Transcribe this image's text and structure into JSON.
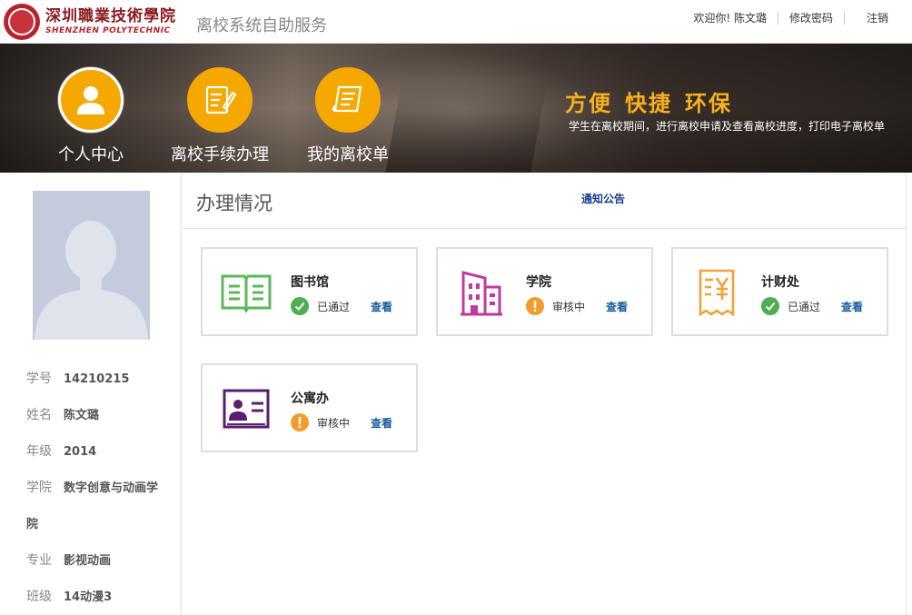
{
  "header": {
    "school_name_cn": "深圳職業技術學院",
    "school_name_en": "SHENZHEN POLYTECHNIC",
    "system_title": "离校系统自助服务",
    "welcome": "欢迎你! 陈文璐",
    "change_password": "修改密码",
    "logout": "注销"
  },
  "banner": {
    "nav": [
      {
        "label": "个人中心",
        "icon": "user-icon",
        "active": true
      },
      {
        "label": "离校手续办理",
        "icon": "edit-form-icon",
        "active": false
      },
      {
        "label": "我的离校单",
        "icon": "scroll-document-icon",
        "active": false
      }
    ],
    "slogan": [
      "方便",
      "快捷",
      "环保"
    ],
    "slogan_sub": "学生在离校期间，进行离校申请及查看离校进度，打印电子离校单"
  },
  "profile": {
    "avatar_icon": "avatar-placeholder-icon",
    "fields": [
      {
        "key": "学号",
        "value": "14210215"
      },
      {
        "key": "姓名",
        "value": "陈文璐"
      },
      {
        "key": "年级",
        "value": "2014"
      },
      {
        "key": "学院",
        "value": "数字创意与动画学"
      },
      {
        "key": "",
        "value": "院"
      },
      {
        "key": "专业",
        "value": "影视动画"
      },
      {
        "key": "班级",
        "value": "14动漫3"
      }
    ]
  },
  "main": {
    "title": "办理情况",
    "notice_link": "通知公告",
    "cards": [
      {
        "name": "图书馆",
        "icon": "book-icon",
        "icon_color": "#5cb85c",
        "status": "已通过",
        "status_type": "ok",
        "view": "查看"
      },
      {
        "name": "学院",
        "icon": "building-icon",
        "icon_color": "#c0399e",
        "status": "审核中",
        "status_type": "wait",
        "view": "查看"
      },
      {
        "name": "计财处",
        "icon": "receipt-yuan-icon",
        "icon_color": "#f2a23a",
        "status": "已通过",
        "status_type": "ok",
        "view": "查看"
      },
      {
        "name": "公寓办",
        "icon": "id-card-icon",
        "icon_color": "#5b1e6e",
        "status": "审核中",
        "status_type": "wait",
        "view": "查看"
      }
    ]
  },
  "colors": {
    "accent_orange": "#f5a800",
    "slogan_gold": "#f6b21b",
    "link_blue": "#1a5c9e",
    "status_ok": "#4caf50",
    "status_wait": "#f39c2b"
  }
}
